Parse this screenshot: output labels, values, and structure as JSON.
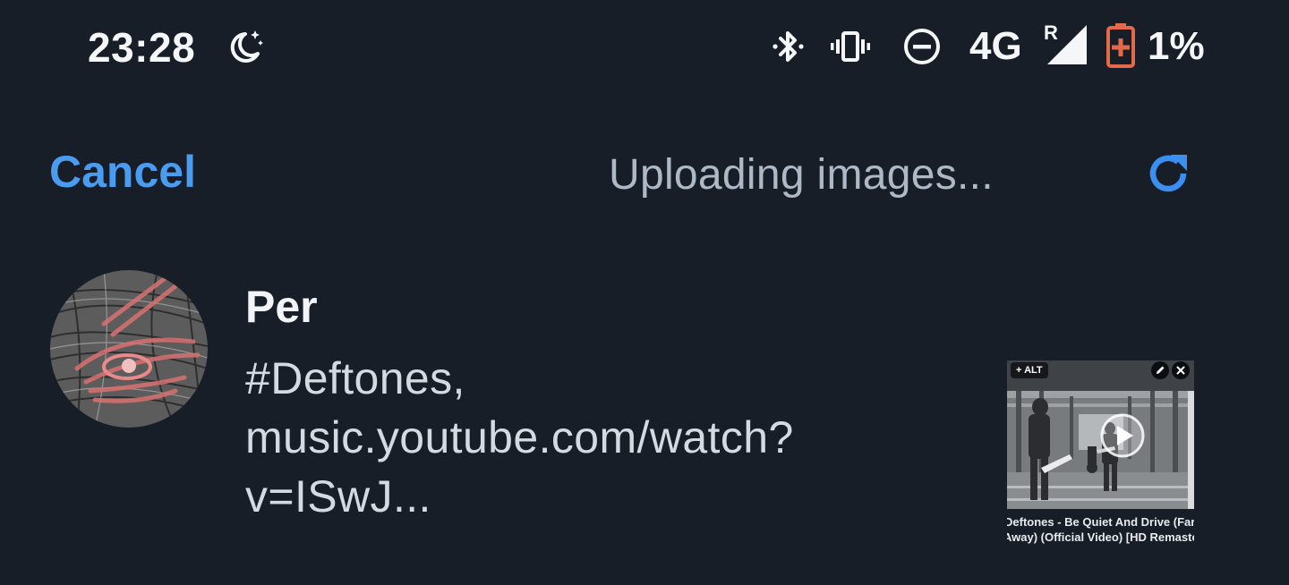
{
  "status_bar": {
    "time": "23:28",
    "network": "4G",
    "roaming": "R",
    "battery": "1%",
    "icons": [
      "night-mode-icon",
      "bluetooth-icon",
      "vibrate-icon",
      "do-not-disturb-icon",
      "signal-icon",
      "battery-charging-icon"
    ],
    "battery_color": "#e2694a"
  },
  "header": {
    "cancel_label": "Cancel",
    "status_text": "Uploading images...",
    "retry_icon": "refresh-icon",
    "accent_color": "#4a9cf0"
  },
  "post": {
    "author": "Per",
    "text_lines": [
      "#Deftones,",
      "music.youtube.com/watch?",
      "v=ISwJ..."
    ]
  },
  "attachment": {
    "alt_label": "+ ALT",
    "caption_lines": [
      "Deftones - Be Quiet And Drive (Far",
      "Away) (Official Video) [HD Remaster"
    ]
  }
}
